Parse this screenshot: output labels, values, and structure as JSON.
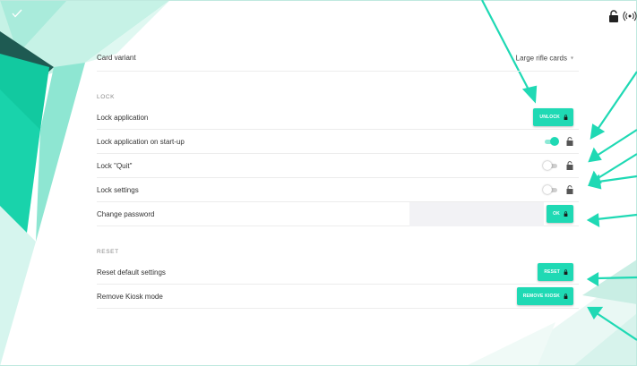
{
  "card_variant": {
    "label": "Card variant",
    "value": "Large rifle cards",
    "caret": "▾"
  },
  "lock_section": {
    "title": "LOCK",
    "rows": [
      {
        "label": "Lock application",
        "button": "UNLOCK"
      },
      {
        "label": "Lock application on start-up",
        "toggle": true
      },
      {
        "label": "Lock \"Quit\"",
        "toggle": false
      },
      {
        "label": "Lock settings",
        "toggle": false
      },
      {
        "label": "Change password",
        "button": "OK"
      }
    ]
  },
  "reset_section": {
    "title": "RESET",
    "rows": [
      {
        "label": "Reset default settings",
        "button": "RESET"
      },
      {
        "label": "Remove Kiosk mode",
        "button": "REMOVE KIOSK"
      }
    ]
  },
  "colors": {
    "accent": "#1fd9b4",
    "arrow": "#1fd9b4"
  },
  "icons": [
    "check-icon",
    "lock-open-icon",
    "wireless-icon",
    "lock-icon",
    "lock-open-icon"
  ]
}
